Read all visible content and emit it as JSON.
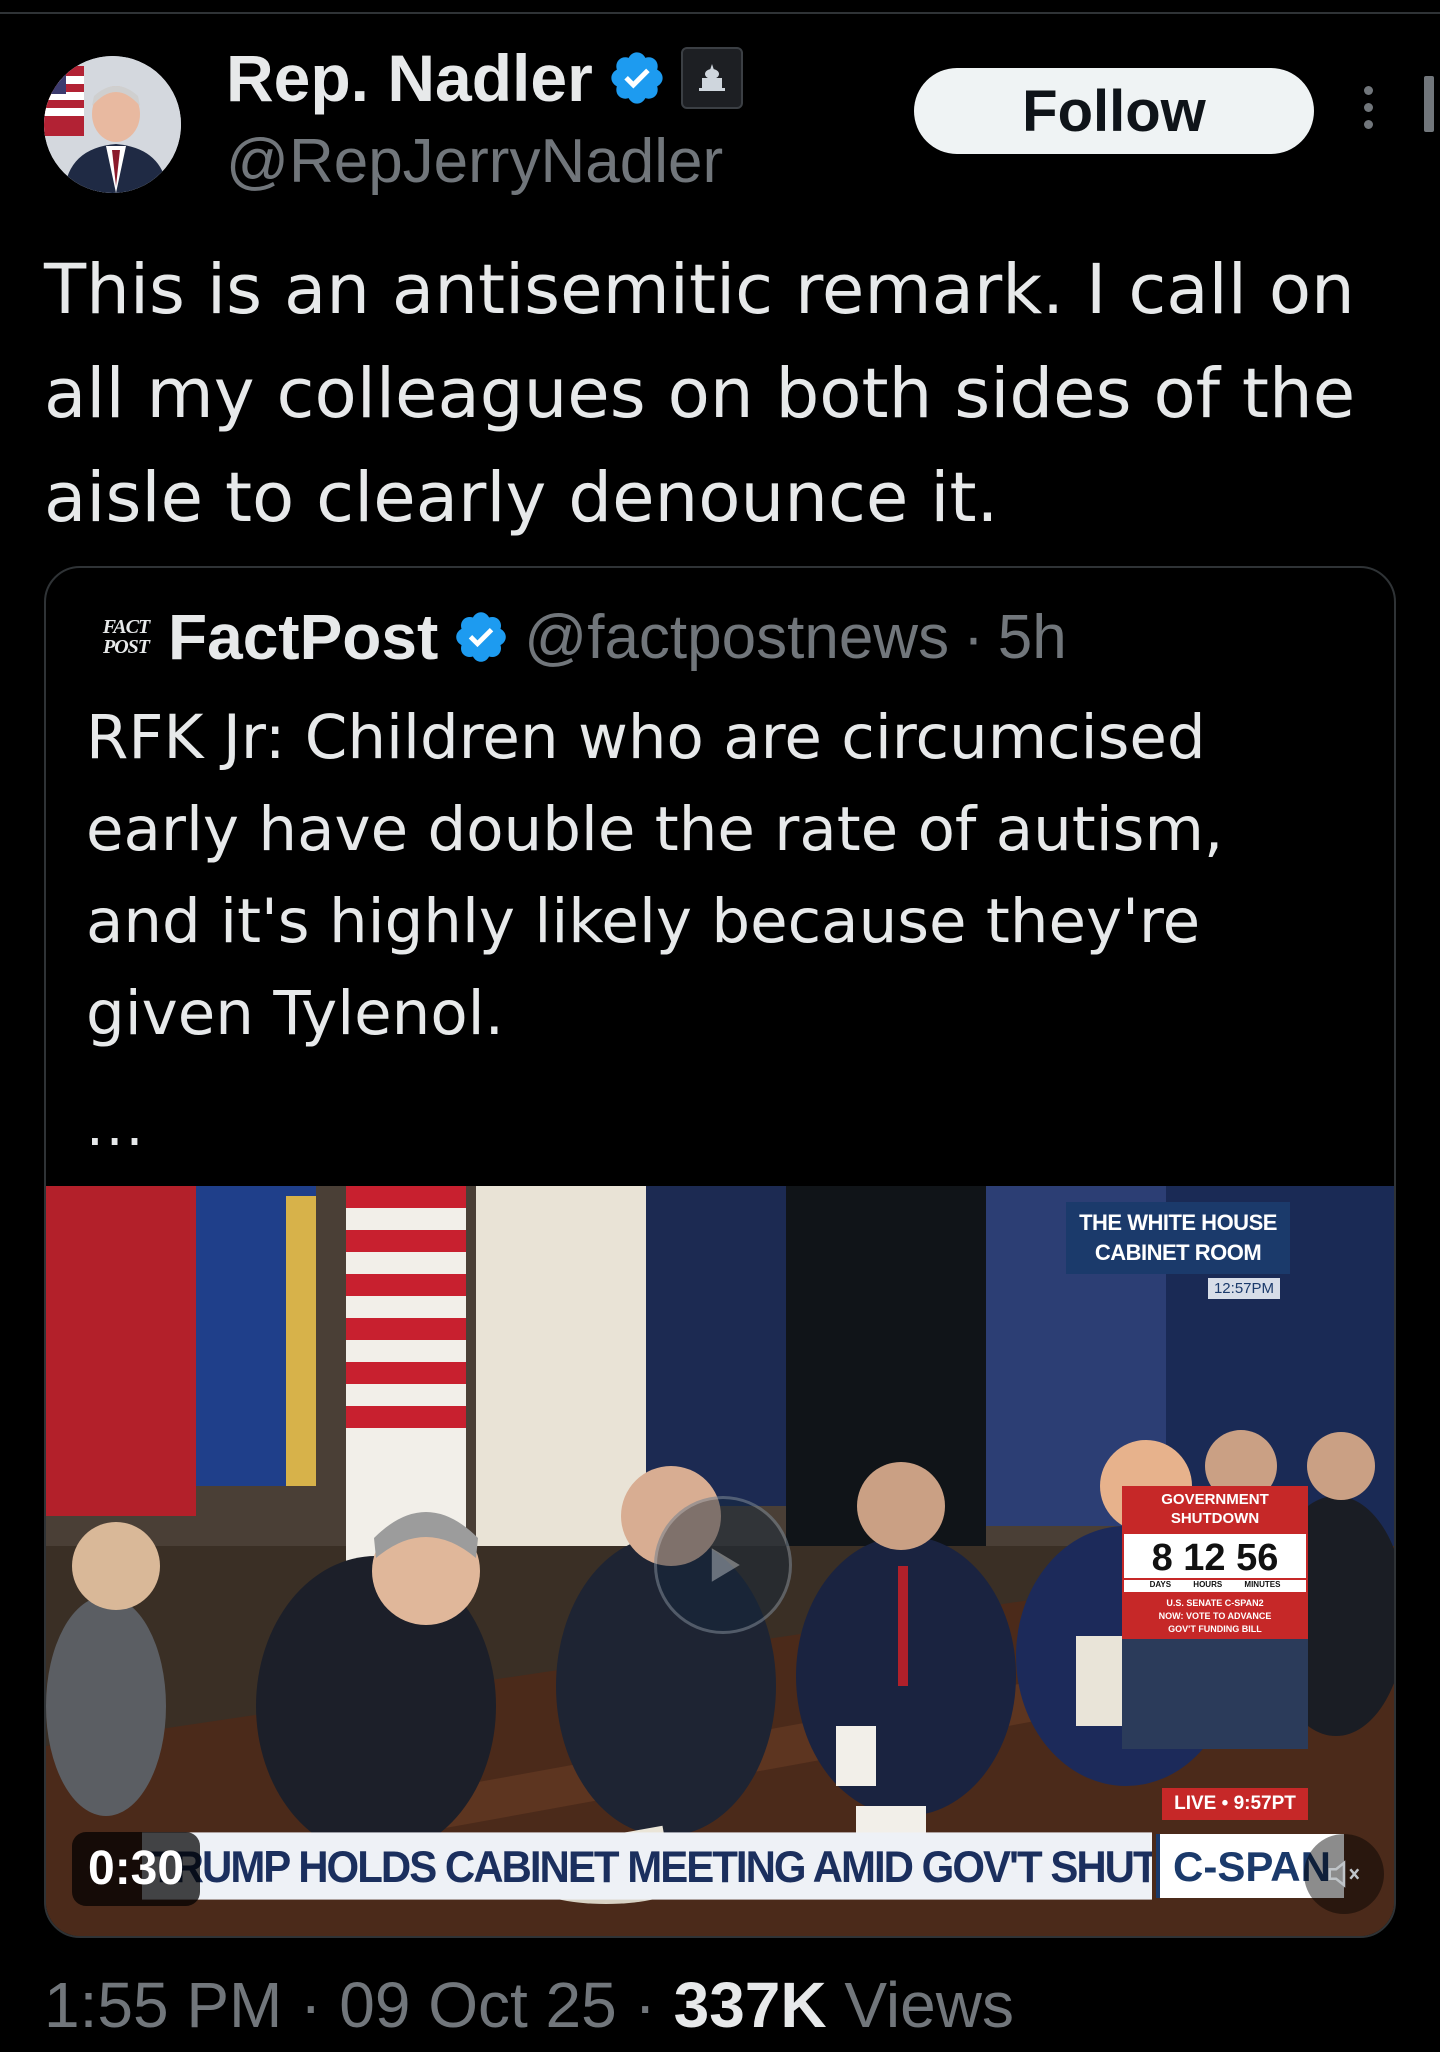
{
  "author": {
    "name": "Rep. Nadler",
    "handle": "@RepJerryNadler",
    "verified_color": "#1d9bf0"
  },
  "follow_label": "Follow",
  "tweet_text": "This is an antisemitic remark. I call on all my colleagues on both sides of the aisle to clearly denounce it.",
  "quote": {
    "logo_line1": "FACT",
    "logo_line2": "POST",
    "name": "FactPost",
    "handle": "@factpostnews",
    "separator": "·",
    "time": "5h",
    "text": "RFK Jr: Children who are circumcised early have double the rate of autism, and it's highly likely because they're given Tylenol.",
    "more": "..."
  },
  "video": {
    "duration": "0:30",
    "overlay": {
      "location_line1": "THE WHITE HOUSE",
      "location_line2": "CABINET ROOM",
      "location_time": "12:57PM",
      "shutdown_title_line1": "GOVERNMENT",
      "shutdown_title_line2": "SHUTDOWN",
      "shutdown_counter": "8 12 56",
      "shutdown_units": "DAYS HOURS MINUTES",
      "senate_line1": "U.S. SENATE C-SPAN2",
      "senate_line2": "NOW: VOTE TO ADVANCE",
      "senate_line3": "GOV'T FUNDING BILL",
      "live_label": "LIVE • 9:57PT",
      "chyron": "TRUMP HOLDS CABINET MEETING AMID GOV'T SHUTDOWN",
      "network": "C-SPAN"
    }
  },
  "meta": {
    "time": "1:55 PM",
    "sep1": "·",
    "date": "09 Oct 25",
    "sep2": "·",
    "views_count": "337K",
    "views_label": "Views"
  },
  "icons": [
    "verified-badge-icon",
    "government-badge-icon",
    "more-options-icon",
    "play-icon",
    "mute-icon"
  ]
}
